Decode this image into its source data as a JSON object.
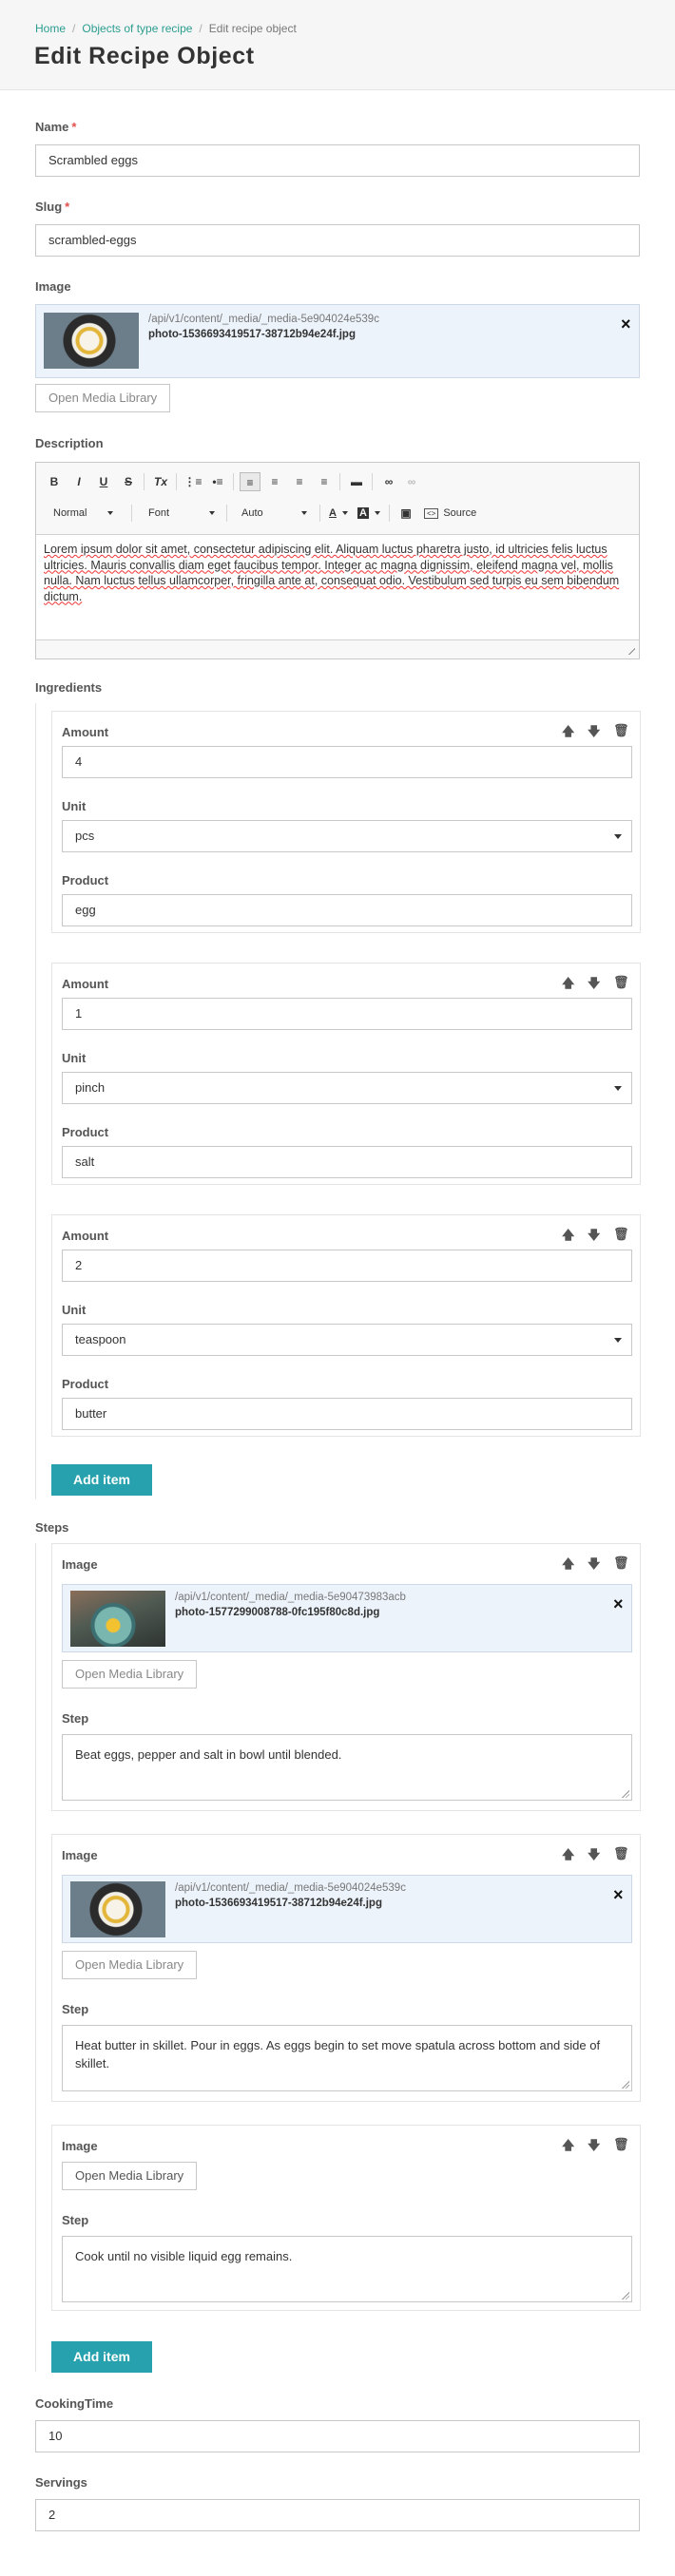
{
  "breadcrumb": {
    "home": "Home",
    "section": "Objects of type recipe",
    "current": "Edit recipe object"
  },
  "page_title": "Edit Recipe Object",
  "fields": {
    "name": {
      "label": "Name",
      "value": "Scrambled eggs"
    },
    "slug": {
      "label": "Slug",
      "value": "scrambled-eggs"
    },
    "image": {
      "label": "Image",
      "url": "/api/v1/content/_media/_media-5e904024e539c",
      "file": "photo-1536693419517-38712b94e24f.jpg",
      "library_button": "Open Media Library"
    },
    "description": {
      "label": "Description",
      "text": "Lorem ipsum dolor sit amet, consectetur adipiscing elit. Aliquam luctus pharetra justo, id ultricies felis luctus ultricies. Mauris convallis diam eget faucibus tempor. Integer ac magna dignissim, eleifend magna vel, mollis nulla. Nam luctus tellus ullamcorper, fringilla ante at, consequat odio. Vestibulum sed turpis eu sem bibendum dictum."
    },
    "cooking_time": {
      "label": "CookingTime",
      "value": "10"
    },
    "servings": {
      "label": "Servings",
      "value": "2"
    }
  },
  "editor_toolbar": {
    "bold": "B",
    "italic": "I",
    "underline": "U",
    "strike": "S",
    "clear": "Tx",
    "format": "Normal",
    "font": "Font",
    "size": "Auto",
    "text_color": "A",
    "bg_color": "A",
    "source": "Source"
  },
  "ingredients": {
    "label": "Ingredients",
    "amount_label": "Amount",
    "unit_label": "Unit",
    "product_label": "Product",
    "items": [
      {
        "amount": "4",
        "unit": "pcs",
        "product": "egg"
      },
      {
        "amount": "1",
        "unit": "pinch",
        "product": "salt"
      },
      {
        "amount": "2",
        "unit": "teaspoon",
        "product": "butter"
      }
    ],
    "add_button": "Add item"
  },
  "steps": {
    "label": "Steps",
    "image_label": "Image",
    "step_label": "Step",
    "library_button": "Open Media Library",
    "items": [
      {
        "url": "/api/v1/content/_media/_media-5e90473983acb",
        "file": "photo-1577299008788-0fc195f80c8d.jpg",
        "text": "Beat eggs, pepper and salt in bowl until blended."
      },
      {
        "url": "/api/v1/content/_media/_media-5e904024e539c",
        "file": "photo-1536693419517-38712b94e24f.jpg",
        "text": "Heat butter in skillet. Pour in eggs. As eggs begin to set move spatula across bottom and side of skillet."
      },
      {
        "text": "Cook until no visible liquid egg remains."
      }
    ],
    "add_button": "Add item"
  },
  "icons": {
    "up": "arrow-up-icon",
    "down": "arrow-down-icon",
    "delete": "trash-icon",
    "remove": "close-icon"
  },
  "colors": {
    "accent": "#27a1ad",
    "link": "#2a9d8f",
    "required": "#e34d4d",
    "media_bg": "#edf3fb"
  }
}
